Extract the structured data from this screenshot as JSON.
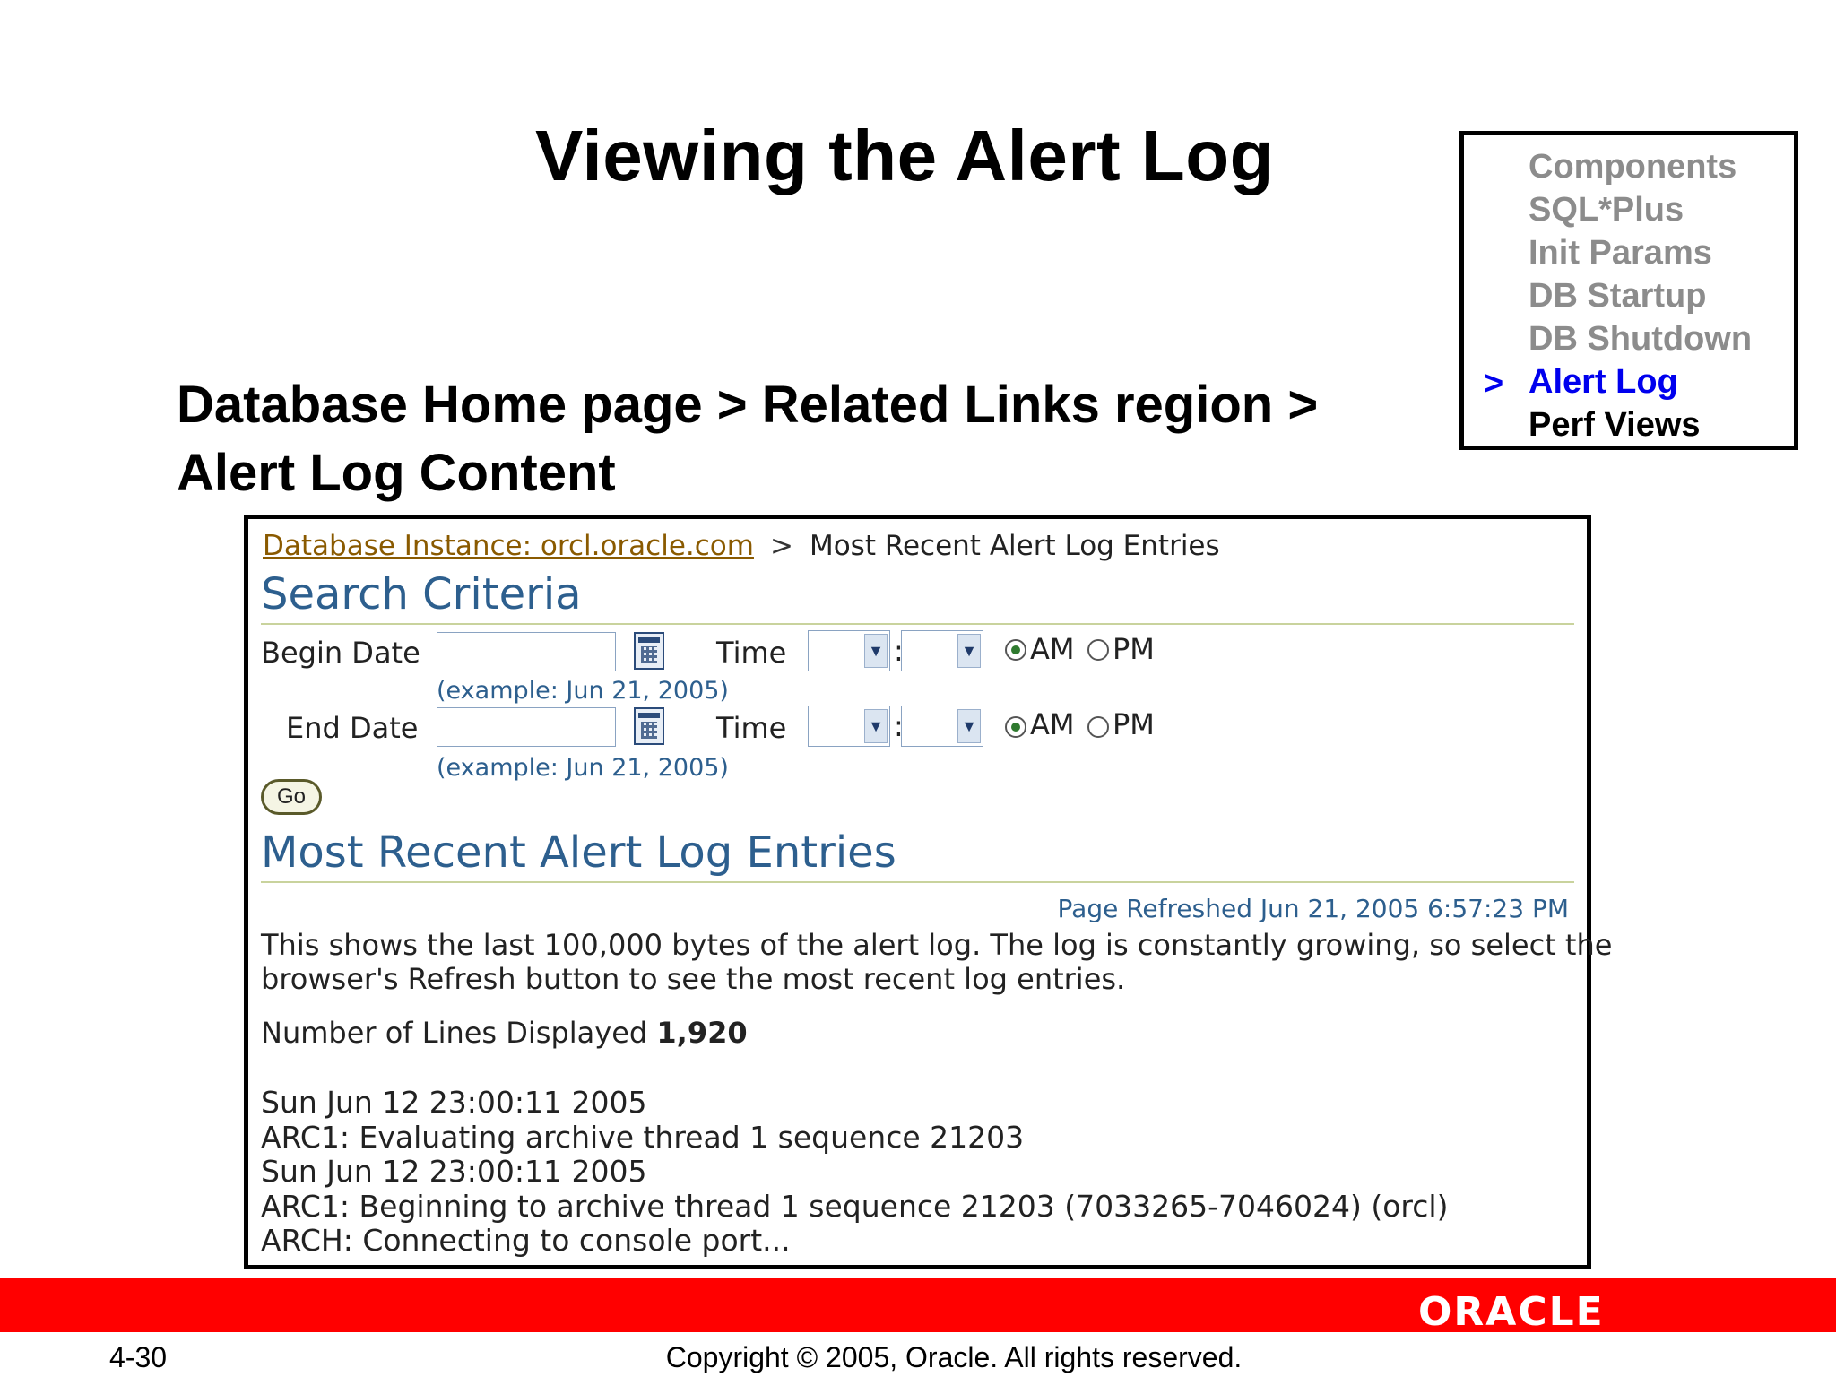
{
  "slide": {
    "title": "Viewing the Alert Log",
    "subtitle_line1": "Database Home page > Related Links region >",
    "subtitle_line2": "Alert Log Content"
  },
  "nav": {
    "marker": ">",
    "items": [
      {
        "label": "Components",
        "state": "inactive"
      },
      {
        "label": "SQL*Plus",
        "state": "inactive"
      },
      {
        "label": "Init Params",
        "state": "inactive"
      },
      {
        "label": "DB Startup",
        "state": "inactive"
      },
      {
        "label": "DB Shutdown",
        "state": "inactive"
      },
      {
        "label": "Alert Log",
        "state": "current"
      },
      {
        "label": "Perf Views",
        "state": "next"
      }
    ]
  },
  "screenshot": {
    "breadcrumb": {
      "link": "Database Instance: orcl.oracle.com",
      "separator": ">",
      "current": "Most Recent Alert Log Entries"
    },
    "search": {
      "heading": "Search Criteria",
      "begin_label": "Begin Date",
      "end_label": "End Date",
      "begin_value": "",
      "end_value": "",
      "example": "(example: Jun 21, 2005)",
      "time_label": "Time",
      "colon": ":",
      "am_label": "AM",
      "pm_label": "PM",
      "go_label": "Go"
    },
    "entries": {
      "heading": "Most Recent Alert Log Entries",
      "refreshed": "Page Refreshed Jun 21, 2005 6:57:23 PM",
      "description_line1": "This shows the last 100,000 bytes of the alert log. The log is constantly growing, so select the",
      "description_line2": "browser's Refresh button to see the most recent log entries.",
      "lines_label": "Number of Lines Displayed",
      "lines_value": "1,920",
      "log_lines": [
        "Sun Jun 12 23:00:11 2005",
        "ARC1: Evaluating archive thread 1 sequence 21203",
        "Sun Jun 12 23:00:11 2005",
        "ARC1: Beginning to archive thread 1 sequence 21203 (7033265-7046024) (orcl)",
        "ARCH: Connecting to console port..."
      ]
    }
  },
  "footer": {
    "page_number": "4-30",
    "copyright": "Copyright © 2005, Oracle.  All rights reserved.",
    "logo": "ORACLE",
    "band_color": "#ff0000"
  }
}
